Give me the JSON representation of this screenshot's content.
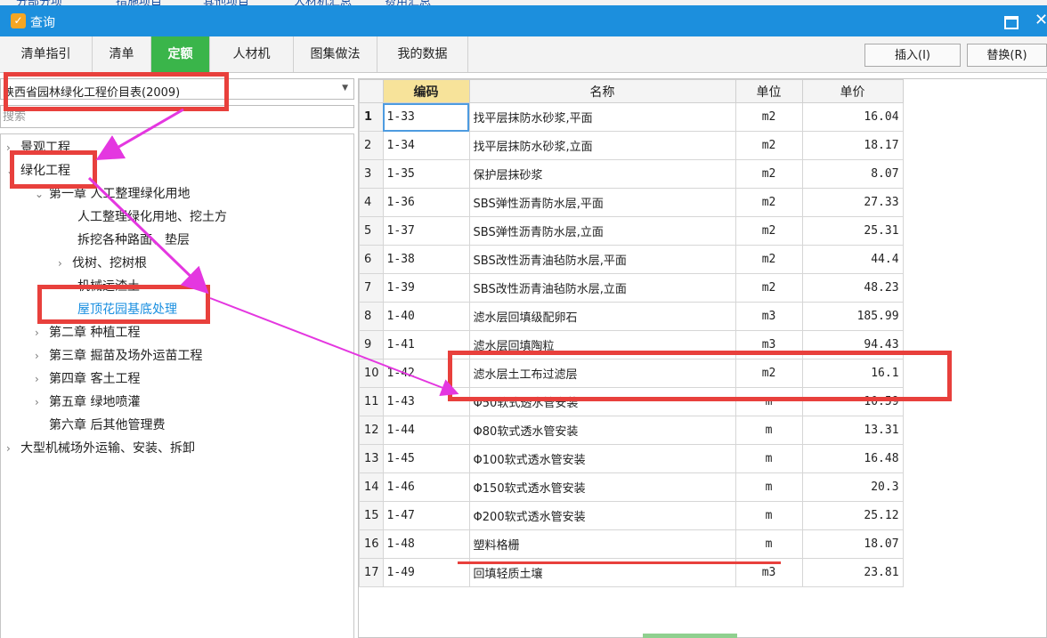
{
  "top_strip": {
    "items": [
      "分部分项",
      "措施项目",
      "其他项目",
      "人材机汇总",
      "费用汇总"
    ]
  },
  "window": {
    "title": "查询",
    "icon": "app-query-icon",
    "title_color": "#1c8fdd"
  },
  "tabs": [
    {
      "label": "清单指引",
      "active": false
    },
    {
      "label": "清单",
      "active": false
    },
    {
      "label": "定额",
      "active": true
    },
    {
      "label": "人材机",
      "active": false
    },
    {
      "label": "图集做法",
      "active": false
    },
    {
      "label": "我的数据",
      "active": false
    }
  ],
  "actions": {
    "insert": "插入(I)",
    "replace": "替换(R)"
  },
  "library_select": {
    "value": "陕西省园林绿化工程价目表(2009)"
  },
  "search": {
    "placeholder": "搜索"
  },
  "tree": [
    {
      "label": "景观工程",
      "level": 0,
      "toggle": "collapsed"
    },
    {
      "label": "绿化工程",
      "level": 0,
      "toggle": "expanded"
    },
    {
      "label": "第一章 人工整理绿化用地",
      "level": 1,
      "toggle": "expanded"
    },
    {
      "label": "人工整理绿化用地、挖土方",
      "level": 2,
      "toggle": "none"
    },
    {
      "label": "拆挖各种路面、垫层",
      "level": 2,
      "toggle": "none"
    },
    {
      "label": "伐树、挖树根",
      "level": 2,
      "toggle": "collapsed"
    },
    {
      "label": "机械运渣土",
      "level": 2,
      "toggle": "none"
    },
    {
      "label": "屋顶花园基底处理",
      "level": 2,
      "toggle": "none",
      "selected": true
    },
    {
      "label": "第二章 种植工程",
      "level": 1,
      "toggle": "collapsed"
    },
    {
      "label": "第三章 掘苗及场外运苗工程",
      "level": 1,
      "toggle": "collapsed"
    },
    {
      "label": "第四章 客土工程",
      "level": 1,
      "toggle": "collapsed"
    },
    {
      "label": "第五章 绿地喷灌",
      "level": 1,
      "toggle": "collapsed"
    },
    {
      "label": "第六章 后其他管理费",
      "level": 1,
      "toggle": "none"
    },
    {
      "label": "大型机械场外运输、安装、拆卸",
      "level": 0,
      "toggle": "collapsed"
    }
  ],
  "grid": {
    "columns": [
      "编码",
      "名称",
      "单位",
      "单价"
    ],
    "rows": [
      [
        "1",
        "1-33",
        "找平层抹防水砂浆,平面",
        "m2",
        "16.04"
      ],
      [
        "2",
        "1-34",
        "找平层抹防水砂浆,立面",
        "m2",
        "18.17"
      ],
      [
        "3",
        "1-35",
        "保护层抹砂浆",
        "m2",
        "8.07"
      ],
      [
        "4",
        "1-36",
        "SBS弹性沥青防水层,平面",
        "m2",
        "27.33"
      ],
      [
        "5",
        "1-37",
        "SBS弹性沥青防水层,立面",
        "m2",
        "25.31"
      ],
      [
        "6",
        "1-38",
        "SBS改性沥青油毡防水层,平面",
        "m2",
        "44.4"
      ],
      [
        "7",
        "1-39",
        "SBS改性沥青油毡防水层,立面",
        "m2",
        "48.23"
      ],
      [
        "8",
        "1-40",
        "滤水层回填级配卵石",
        "m3",
        "185.99"
      ],
      [
        "9",
        "1-41",
        "滤水层回填陶粒",
        "m3",
        "94.43"
      ],
      [
        "10",
        "1-42",
        "滤水层土工布过滤层",
        "m2",
        "16.1"
      ],
      [
        "11",
        "1-43",
        "Φ50软式透水管安装",
        "m",
        "10.59"
      ],
      [
        "12",
        "1-44",
        "Φ80软式透水管安装",
        "m",
        "13.31"
      ],
      [
        "13",
        "1-45",
        "Φ100软式透水管安装",
        "m",
        "16.48"
      ],
      [
        "14",
        "1-46",
        "Φ150软式透水管安装",
        "m",
        "20.3"
      ],
      [
        "15",
        "1-47",
        "Φ200软式透水管安装",
        "m",
        "25.12"
      ],
      [
        "16",
        "1-48",
        "塑料格栅",
        "m",
        "18.07"
      ],
      [
        "17",
        "1-49",
        "回填轻质土壤",
        "m3",
        "23.81"
      ]
    ]
  },
  "annotation_color": "#e8403c",
  "arrow_color": "#e437e0"
}
